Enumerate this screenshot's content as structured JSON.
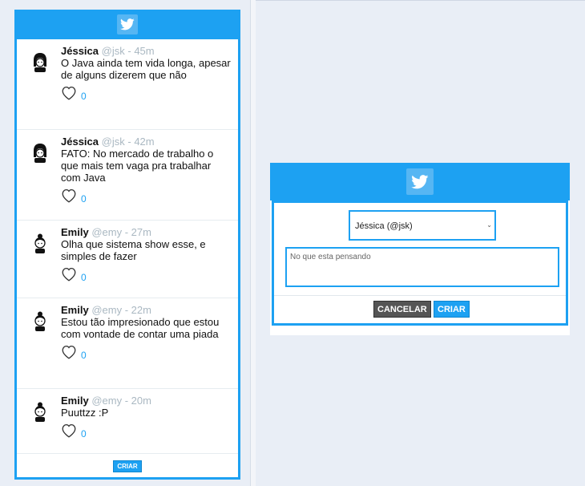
{
  "colors": {
    "accent": "#1da1f2",
    "muted": "#aab8c2",
    "dark_button": "#555555"
  },
  "feed": {
    "header_icon": "twitter-bird-icon",
    "tweets": [
      {
        "name": "Jéssica",
        "handle": "@jsk",
        "sep": "-",
        "time": "45m",
        "text": "O Java ainda tem vida longa, apesar de alguns dizerem que não",
        "likes": "0",
        "avatar": "girl-avatar-icon"
      },
      {
        "name": "Jéssica",
        "handle": "@jsk",
        "sep": "-",
        "time": "42m",
        "text": "FATO: No mercado de trabalho o que mais tem vaga pra trabalhar com Java",
        "likes": "0",
        "avatar": "girl-avatar-icon"
      },
      {
        "name": "Emily",
        "handle": "@emy",
        "sep": "-",
        "time": "27m",
        "text": "Olha que sistema show esse, e simples de fazer",
        "likes": "0",
        "avatar": "girl-bun-avatar-icon"
      },
      {
        "name": "Emily",
        "handle": "@emy",
        "sep": "-",
        "time": "22m",
        "text": "Estou tão impresionado que estou com vontade de contar uma piada",
        "likes": "0",
        "avatar": "girl-bun-avatar-icon"
      },
      {
        "name": "Emily",
        "handle": "@emy",
        "sep": "-",
        "time": "20m",
        "text": "Puuttzz :P",
        "likes": "0",
        "avatar": "girl-bun-avatar-icon"
      }
    ],
    "criar_label": "CRIAR"
  },
  "modal": {
    "header_icon": "twitter-bird-icon",
    "user_select_value": "Jéssica (@jsk)",
    "textarea_placeholder": "No que esta pensando",
    "cancel_label": "CANCELAR",
    "create_label": "CRIAR"
  }
}
